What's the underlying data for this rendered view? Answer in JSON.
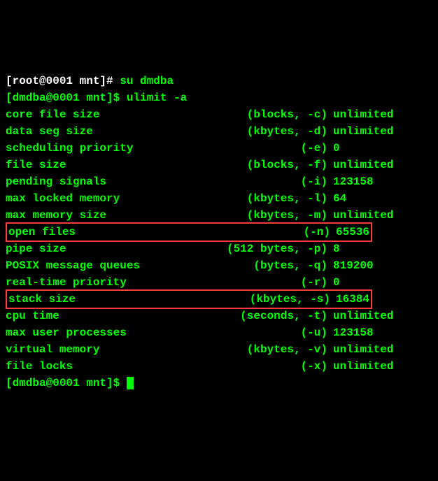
{
  "prompts": {
    "root": "[root@0001 mnt]# ",
    "user": "[dmdba@0001 mnt]$ "
  },
  "commands": {
    "su": "su dmdba",
    "ulimit": "ulimit -a"
  },
  "rows": [
    {
      "name": "core file size",
      "unit": "(blocks, -c)",
      "value": "unlimited",
      "hl": false
    },
    {
      "name": "data seg size",
      "unit": "(kbytes, -d)",
      "value": "unlimited",
      "hl": false
    },
    {
      "name": "scheduling priority",
      "unit": "(-e)",
      "value": "0",
      "hl": false
    },
    {
      "name": "file size",
      "unit": "(blocks, -f)",
      "value": "unlimited",
      "hl": false
    },
    {
      "name": "pending signals",
      "unit": "(-i)",
      "value": "123158",
      "hl": false
    },
    {
      "name": "max locked memory",
      "unit": "(kbytes, -l)",
      "value": "64",
      "hl": false
    },
    {
      "name": "max memory size",
      "unit": "(kbytes, -m)",
      "value": "unlimited",
      "hl": false
    },
    {
      "name": "open files",
      "unit": "(-n)",
      "value": "65536",
      "hl": true
    },
    {
      "name": "pipe size",
      "unit": "(512 bytes, -p)",
      "value": "8",
      "hl": false
    },
    {
      "name": "POSIX message queues",
      "unit": "(bytes, -q)",
      "value": "819200",
      "hl": false
    },
    {
      "name": "real-time priority",
      "unit": "(-r)",
      "value": "0",
      "hl": false
    },
    {
      "name": "stack size",
      "unit": "(kbytes, -s)",
      "value": "16384",
      "hl": true
    },
    {
      "name": "cpu time",
      "unit": "(seconds, -t)",
      "value": "unlimited",
      "hl": false
    },
    {
      "name": "max user processes",
      "unit": "(-u)",
      "value": "123158",
      "hl": false
    },
    {
      "name": "virtual memory",
      "unit": "(kbytes, -v)",
      "value": "unlimited",
      "hl": false
    },
    {
      "name": "file locks",
      "unit": "(-x)",
      "value": "unlimited",
      "hl": false
    }
  ]
}
